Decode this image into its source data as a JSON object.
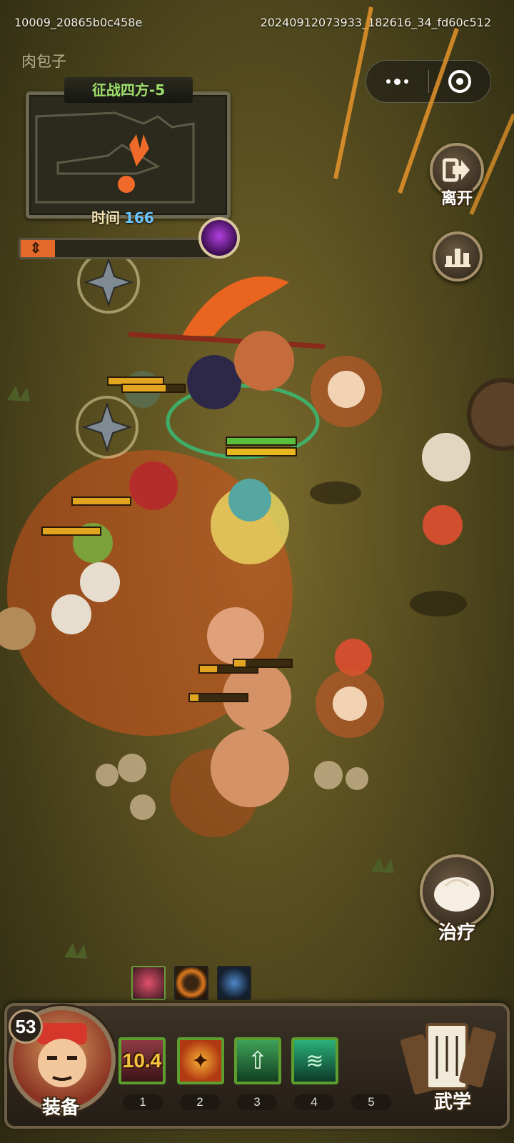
{
  "header": {
    "session_id": "10009_20865b0c458e",
    "timestamp_id": "20240912073933_182616_34_fd60c512",
    "player_name": "肉包子"
  },
  "minimap": {
    "stage_title": "征战四方-5",
    "time_label": "时间",
    "time_value": "166",
    "progress_fraction": 0.17
  },
  "side_buttons": {
    "leave_label": "离开",
    "stats_icon": "bar-chart-icon",
    "heal_label": "治疗"
  },
  "hero": {
    "level": "53",
    "equip_label": "装备"
  },
  "skills": [
    {
      "slot": "1",
      "cooldown": "10.4",
      "icon": "crimson-burst-skill-icon"
    },
    {
      "slot": "2",
      "cooldown": "",
      "icon": "flame-warrior-skill-icon"
    },
    {
      "slot": "3",
      "cooldown": "",
      "icon": "heal-arrow-skill-icon"
    },
    {
      "slot": "4",
      "cooldown": "",
      "icon": "jade-claw-skill-icon"
    },
    {
      "slot": "5",
      "cooldown": "",
      "icon": "empty-slot"
    }
  ],
  "martial_label": "武学",
  "buffs": [
    "red-spikes-buff-icon",
    "fire-ring-buff-icon",
    "blue-potion-buff-icon"
  ],
  "colors": {
    "minimap_title": "#9fe06c",
    "timer_value": "#6cc6ff",
    "slot_border": "#5d9e2f",
    "progress": "#e36a2a"
  }
}
